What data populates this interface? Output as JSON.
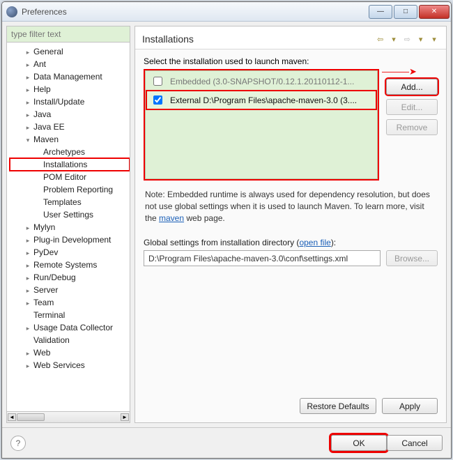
{
  "window": {
    "title": "Preferences"
  },
  "filter": {
    "placeholder": "type filter text"
  },
  "tree": [
    {
      "label": "General",
      "level": 1,
      "expandable": true
    },
    {
      "label": "Ant",
      "level": 1,
      "expandable": true
    },
    {
      "label": "Data Management",
      "level": 1,
      "expandable": true
    },
    {
      "label": "Help",
      "level": 1,
      "expandable": true
    },
    {
      "label": "Install/Update",
      "level": 1,
      "expandable": true
    },
    {
      "label": "Java",
      "level": 1,
      "expandable": true
    },
    {
      "label": "Java EE",
      "level": 1,
      "expandable": true
    },
    {
      "label": "Maven",
      "level": 1,
      "expandable": true,
      "expanded": true
    },
    {
      "label": "Archetypes",
      "level": 2
    },
    {
      "label": "Installations",
      "level": 2,
      "selected": true
    },
    {
      "label": "POM Editor",
      "level": 2
    },
    {
      "label": "Problem Reporting",
      "level": 2
    },
    {
      "label": "Templates",
      "level": 2
    },
    {
      "label": "User Settings",
      "level": 2
    },
    {
      "label": "Mylyn",
      "level": 1,
      "expandable": true
    },
    {
      "label": "Plug-in Development",
      "level": 1,
      "expandable": true
    },
    {
      "label": "PyDev",
      "level": 1,
      "expandable": true
    },
    {
      "label": "Remote Systems",
      "level": 1,
      "expandable": true
    },
    {
      "label": "Run/Debug",
      "level": 1,
      "expandable": true
    },
    {
      "label": "Server",
      "level": 1,
      "expandable": true
    },
    {
      "label": "Team",
      "level": 1,
      "expandable": true
    },
    {
      "label": "Terminal",
      "level": 1
    },
    {
      "label": "Usage Data Collector",
      "level": 1,
      "expandable": true
    },
    {
      "label": "Validation",
      "level": 1
    },
    {
      "label": "Web",
      "level": 1,
      "expandable": true
    },
    {
      "label": "Web Services",
      "level": 1,
      "expandable": true
    }
  ],
  "panel": {
    "heading": "Installations",
    "select_label": "Select the installation used to launch maven:",
    "installations": [
      {
        "label": "Embedded (3.0-SNAPSHOT/0.12.1.20110112-1...",
        "checked": false,
        "selected": false
      },
      {
        "label": "External D:\\Program Files\\apache-maven-3.0 (3....",
        "checked": true,
        "selected": true
      }
    ],
    "buttons": {
      "add": "Add...",
      "edit": "Edit...",
      "remove": "Remove"
    },
    "note_prefix": "Note: Embedded runtime is always used for dependency resolution, but does not use global settings when it is used to launch Maven. To learn more, visit the ",
    "note_link": "maven",
    "note_suffix": " web page.",
    "global_label_prefix": "Global settings from installation directory (",
    "global_link": "open file",
    "global_label_suffix": "):",
    "global_value": "D:\\Program Files\\apache-maven-3.0\\conf\\settings.xml",
    "browse": "Browse...",
    "restore": "Restore Defaults",
    "apply": "Apply"
  },
  "footer": {
    "ok": "OK",
    "cancel": "Cancel"
  }
}
